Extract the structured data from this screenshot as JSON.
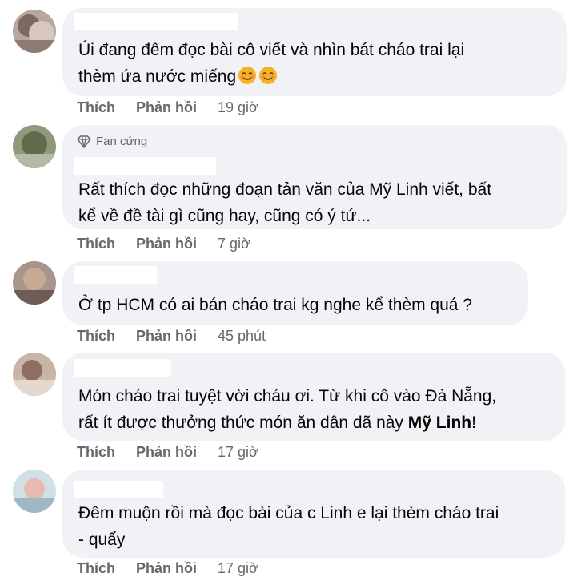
{
  "comments": [
    {
      "text_lines": [
        "Úi đang đêm đọc bài cô viết và nhìn bát cháo trai lại",
        "thèm ứa nước miếng"
      ],
      "emojis": [
        "smiling-face-icon",
        "smiling-face-icon"
      ],
      "like": "Thích",
      "reply": "Phản hồi",
      "time": "19 giờ"
    },
    {
      "badge": "Fan cứng",
      "text_lines": [
        "Rất thích đọc những đoạn tản văn của Mỹ Linh viết, bất",
        "kể về đề tài gì cũng hay, cũng có ý tứ..."
      ],
      "like": "Thích",
      "reply": "Phản hồi",
      "time": "7 giờ"
    },
    {
      "text_lines": [
        "Ở tp HCM có ai bán cháo trai kg nghe kể thèm quá ?"
      ],
      "like": "Thích",
      "reply": "Phản hồi",
      "time": "45 phút"
    },
    {
      "text_lines": [
        "Món cháo trai tuyệt vời cháu ơi. Từ khi cô vào Đà Nẵng,"
      ],
      "text_line2_prefix": "rất ít được thưởng thức món ăn dân dã này ",
      "text_line2_mention": "Mỹ Linh",
      "text_line2_suffix": "!",
      "like": "Thích",
      "reply": "Phản hồi",
      "time": "17 giờ"
    },
    {
      "text_lines": [
        "Đêm muộn rồi mà đọc bài của c Linh e lại thèm cháo trai",
        "- quẩy"
      ],
      "like": "Thích",
      "reply": "Phản hồi",
      "time": "17 giờ"
    }
  ],
  "colors": {
    "bubble": "#f0f2f5",
    "text": "#050505",
    "secondary": "#65676b"
  }
}
